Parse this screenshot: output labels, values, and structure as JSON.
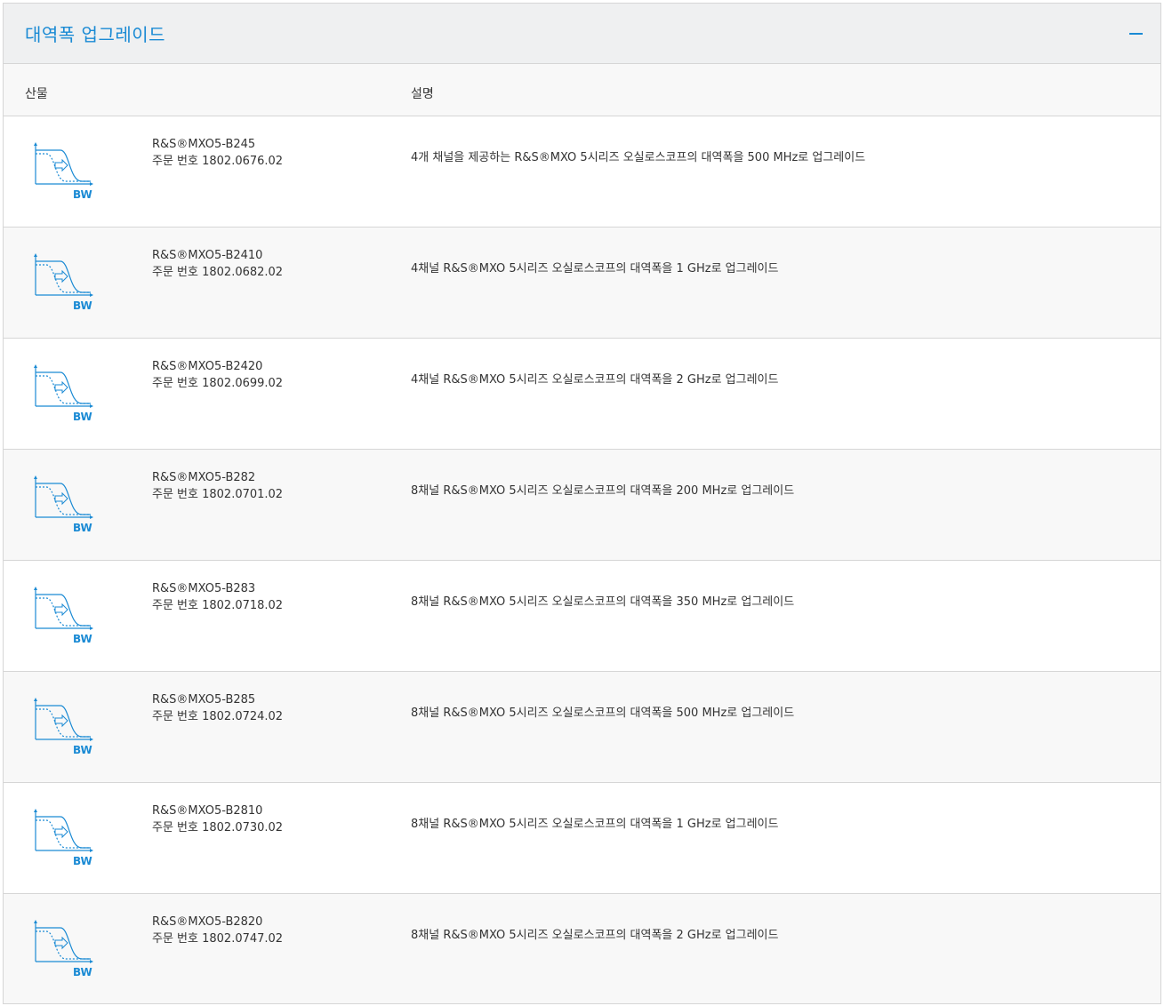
{
  "panel": {
    "title": "대역폭 업그레이드"
  },
  "columns": {
    "product": "산물",
    "description": "설명"
  },
  "icon": {
    "name": "bandwidth-icon",
    "label": "BW",
    "color": "#1a8ad4"
  },
  "rows": [
    {
      "name": "R&S®MXO5-B245",
      "order": "주문 번호 1802.0676.02",
      "description": "4개 채널을 제공하는 R&S®MXO 5시리즈 오실로스코프의 대역폭을 500 MHz로 업그레이드"
    },
    {
      "name": "R&S®MXO5-B2410",
      "order": "주문 번호 1802.0682.02",
      "description": "4채널 R&S®MXO 5시리즈 오실로스코프의 대역폭을 1 GHz로 업그레이드"
    },
    {
      "name": "R&S®MXO5-B2420",
      "order": "주문 번호 1802.0699.02",
      "description": "4채널 R&S®MXO 5시리즈 오실로스코프의 대역폭을 2 GHz로 업그레이드"
    },
    {
      "name": "R&S®MXO5-B282",
      "order": "주문 번호 1802.0701.02",
      "description": "8채널 R&S®MXO 5시리즈 오실로스코프의 대역폭을 200 MHz로 업그레이드"
    },
    {
      "name": "R&S®MXO5-B283",
      "order": "주문 번호 1802.0718.02",
      "description": "8채널 R&S®MXO 5시리즈 오실로스코프의 대역폭을 350 MHz로 업그레이드"
    },
    {
      "name": "R&S®MXO5-B285",
      "order": "주문 번호 1802.0724.02",
      "description": "8채널 R&S®MXO 5시리즈 오실로스코프의 대역폭을 500 MHz로 업그레이드"
    },
    {
      "name": "R&S®MXO5-B2810",
      "order": "주문 번호 1802.0730.02",
      "description": "8채널 R&S®MXO 5시리즈 오실로스코프의 대역폭을 1 GHz로 업그레이드"
    },
    {
      "name": "R&S®MXO5-B2820",
      "order": "주문 번호 1802.0747.02",
      "description": "8채널 R&S®MXO 5시리즈 오실로스코프의 대역폭을 2 GHz로 업그레이드"
    }
  ]
}
